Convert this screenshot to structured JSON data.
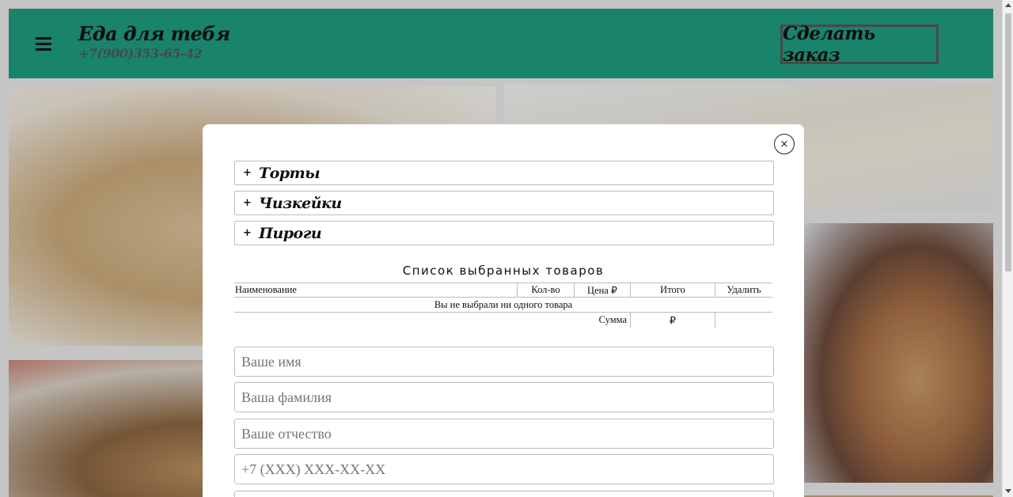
{
  "header": {
    "title": "Еда для тебя",
    "phone": "+7(900)353-65-42",
    "order_button": "Сделать заказ",
    "background_color": "#1e9a7e"
  },
  "gallery": {
    "photos": [
      "napoleon-cake-photo",
      "grilled-sandwich-photo",
      "cheesecake-photo",
      "pie-photo",
      "dessert-photo"
    ]
  },
  "modal": {
    "close_icon": "×",
    "categories": [
      {
        "plus": "+",
        "label": "Торты"
      },
      {
        "plus": "+",
        "label": "Чизкейки"
      },
      {
        "plus": "+",
        "label": "Пироги"
      }
    ],
    "list_title": "Список выбранных товаров",
    "table": {
      "headers": {
        "name": "Наименование",
        "qty": "Кол-во",
        "price": "Цена ₽",
        "total": "Итого",
        "delete": "Удалить"
      },
      "empty_message": "Вы не выбрали ни одного товара",
      "sum_label": "Сумма",
      "sum_value": "₽"
    },
    "form": {
      "first_name_placeholder": "Ваше имя",
      "last_name_placeholder": "Ваша фамилия",
      "patronymic_placeholder": "Ваше отчество",
      "phone_placeholder": "+7 (XXX) XXX-XX-XX"
    }
  }
}
